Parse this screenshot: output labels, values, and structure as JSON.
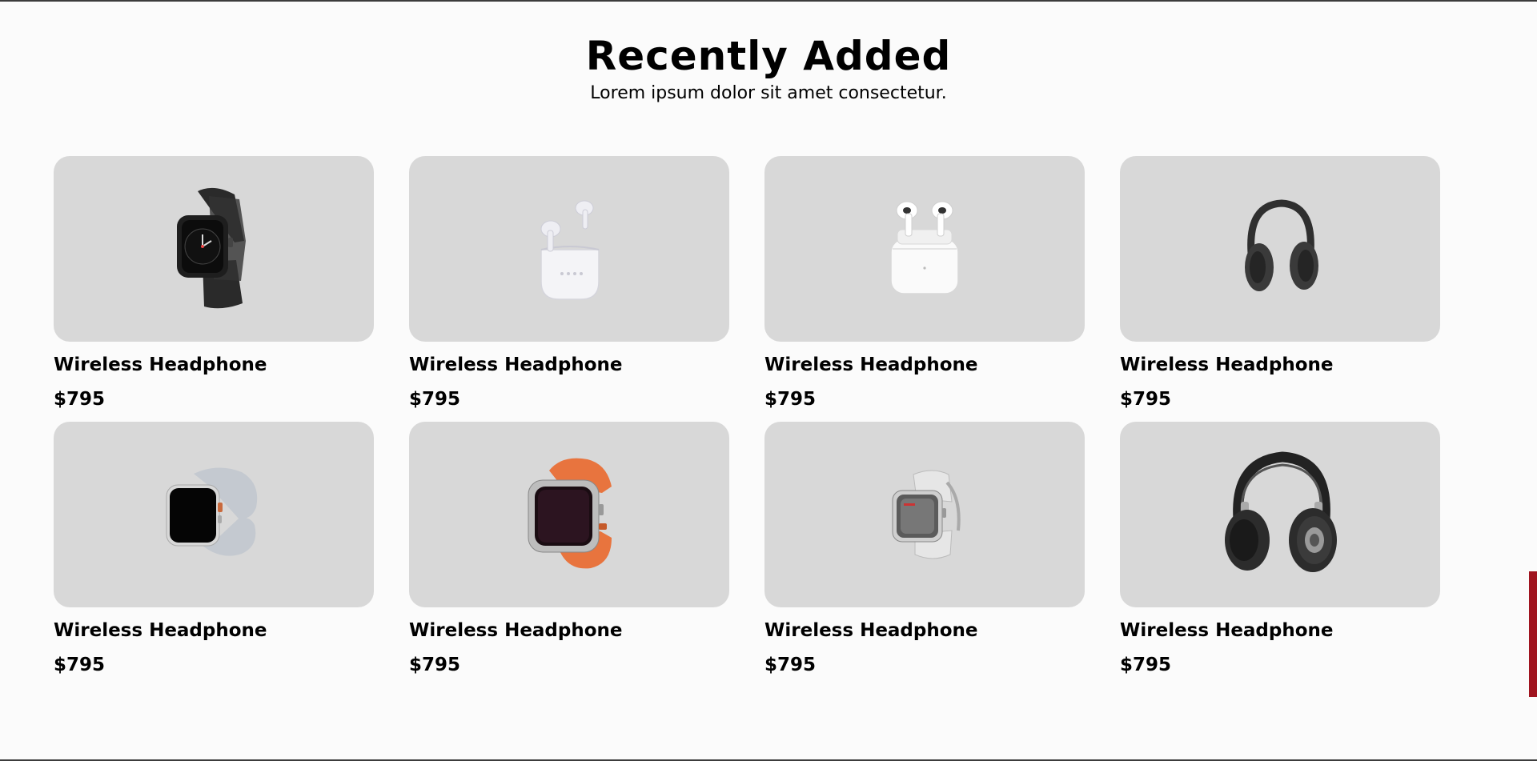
{
  "section": {
    "title": "Recently Added",
    "subtitle": "Lorem ipsum dolor sit amet consectetur."
  },
  "products": [
    {
      "name": "Wireless Headphone",
      "price": "$795",
      "icon": "black-smartwatch-icon"
    },
    {
      "name": "Wireless Headphone",
      "price": "$795",
      "icon": "earbuds-open-case-icon"
    },
    {
      "name": "Wireless Headphone",
      "price": "$795",
      "icon": "airpods-case-icon"
    },
    {
      "name": "Wireless Headphone",
      "price": "$795",
      "icon": "small-headphones-icon"
    },
    {
      "name": "Wireless Headphone",
      "price": "$795",
      "icon": "grey-band-smartwatch-icon"
    },
    {
      "name": "Wireless Headphone",
      "price": "$795",
      "icon": "orange-band-smartwatch-icon"
    },
    {
      "name": "Wireless Headphone",
      "price": "$795",
      "icon": "white-smartwatch-icon"
    },
    {
      "name": "Wireless Headphone",
      "price": "$795",
      "icon": "large-headphones-icon"
    }
  ],
  "colors": {
    "background": "#fbfbfb",
    "card": "#d8d8d8",
    "accent_tab": "#a0141f"
  }
}
